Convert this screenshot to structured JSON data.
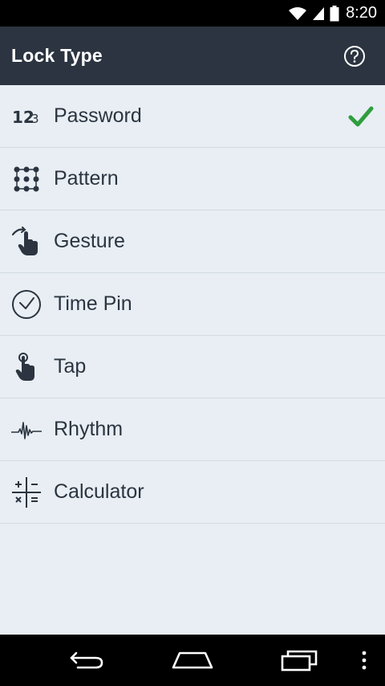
{
  "status_bar": {
    "time": "8:20",
    "icons": [
      "wifi-icon",
      "signal-icon",
      "battery-icon"
    ]
  },
  "app_bar": {
    "title": "Lock Type",
    "help_icon": "help-circle-icon"
  },
  "lock_types": [
    {
      "label": "Password",
      "icon": "password-123-icon",
      "selected": true
    },
    {
      "label": "Pattern",
      "icon": "pattern-grid-icon",
      "selected": false
    },
    {
      "label": "Gesture",
      "icon": "gesture-hand-icon",
      "selected": false
    },
    {
      "label": "Time Pin",
      "icon": "clock-icon",
      "selected": false
    },
    {
      "label": "Tap",
      "icon": "tap-finger-icon",
      "selected": false
    },
    {
      "label": "Rhythm",
      "icon": "rhythm-wave-icon",
      "selected": false
    },
    {
      "label": "Calculator",
      "icon": "calculator-icon",
      "selected": false
    }
  ],
  "colors": {
    "app_bar": "#2b3440",
    "background": "#e8eef3",
    "check": "#2e9e3e"
  },
  "nav_bar": {
    "icons": [
      "back-icon",
      "home-icon",
      "recents-icon",
      "overflow-menu-icon"
    ]
  }
}
